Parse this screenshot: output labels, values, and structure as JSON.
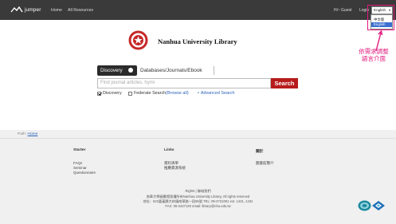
{
  "topbar": {
    "brand": "jumper",
    "nav": [
      "Home",
      "All Resources"
    ],
    "user": "Hi~ Guest",
    "login": "Login",
    "language": {
      "selected": "English",
      "options": [
        "中文版",
        "English"
      ]
    }
  },
  "annotation": {
    "text_line1": "依需求調整",
    "text_line2": "語言介面",
    "color": "#e0197d"
  },
  "header": {
    "library_name": "Nanhua University Library"
  },
  "search": {
    "tabs": [
      "Discovery",
      "Databases/Journals/Ebook"
    ],
    "placeholder": "Find journal articles, hymi",
    "button": "Search",
    "options": {
      "discovery": "Discovery",
      "federate": "Federate Search",
      "browse_all": "(Browse all)",
      "advanced": "Advanced Search"
    }
  },
  "footer": {
    "path_label": "Path:",
    "path_link": "Home",
    "columns": [
      {
        "heading": "Starter",
        "items": [
          "FAQs",
          "Seminar",
          "Questionnaire"
        ]
      },
      {
        "heading": "Links",
        "items": [
          "資料清單",
          "推薦資源系統"
        ]
      },
      {
        "heading": "關於",
        "items": [
          "圖書館簡介"
        ]
      }
    ],
    "rights": "Rights  |  聯絡我們",
    "copyright": "南華大學圖書館版權所有Nanhua University Library, All rights reserved",
    "address": "地址：622嘉義縣大林鎮南華路一段55號 TEL: 05-2721001 ext. 1421, 1431",
    "fax": "FAX: 05-2427120 email: library@nhu.edu.tw"
  },
  "colors": {
    "topbar": "#3a3a3a",
    "search_button": "#b71c1c",
    "footer_bg": "#f0f0f0",
    "link": "#2a63b8"
  }
}
